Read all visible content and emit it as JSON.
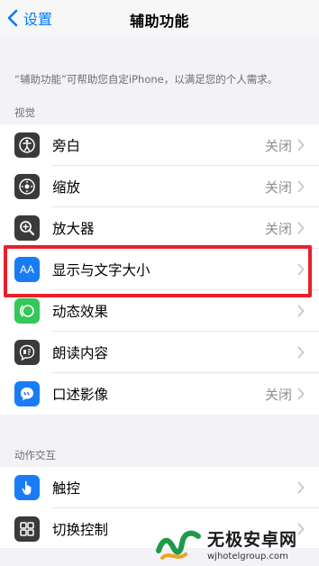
{
  "nav": {
    "back_label": "设置",
    "title": "辅助功能"
  },
  "description": "“辅助功能”可帮助您自定iPhone，以满足您的个人需求。",
  "sections": [
    {
      "header": "视觉",
      "rows": [
        {
          "label": "旁白",
          "value": "关闭",
          "icon": "voiceover-icon",
          "color": "#3a3a3c"
        },
        {
          "label": "缩放",
          "value": "关闭",
          "icon": "zoom-icon",
          "color": "#3a3a3c"
        },
        {
          "label": "放大器",
          "value": "关闭",
          "icon": "magnifier-icon",
          "color": "#3a3a3c"
        },
        {
          "label": "显示与文字大小",
          "value": "",
          "icon": "display-text-size-icon",
          "color": "#1a7cf5",
          "icon_text": "AA"
        },
        {
          "label": "动态效果",
          "value": "",
          "icon": "motion-icon",
          "color": "#34c759"
        },
        {
          "label": "朗读内容",
          "value": "",
          "icon": "spoken-content-icon",
          "color": "#3a3a3c"
        },
        {
          "label": "口述影像",
          "value": "关闭",
          "icon": "audio-descriptions-icon",
          "color": "#1a7cf5"
        }
      ]
    },
    {
      "header": "动作交互",
      "rows": [
        {
          "label": "触控",
          "value": "",
          "icon": "touch-icon",
          "color": "#1a7cf5"
        },
        {
          "label": "切换控制",
          "value": "",
          "icon": "switch-control-icon",
          "color": "#3a3a3c"
        }
      ]
    }
  ],
  "watermark": {
    "main": "无极安卓网",
    "url": "wjhotelgroup.com"
  },
  "colors": {
    "accent": "#007aff",
    "highlight": "#e8202a"
  }
}
